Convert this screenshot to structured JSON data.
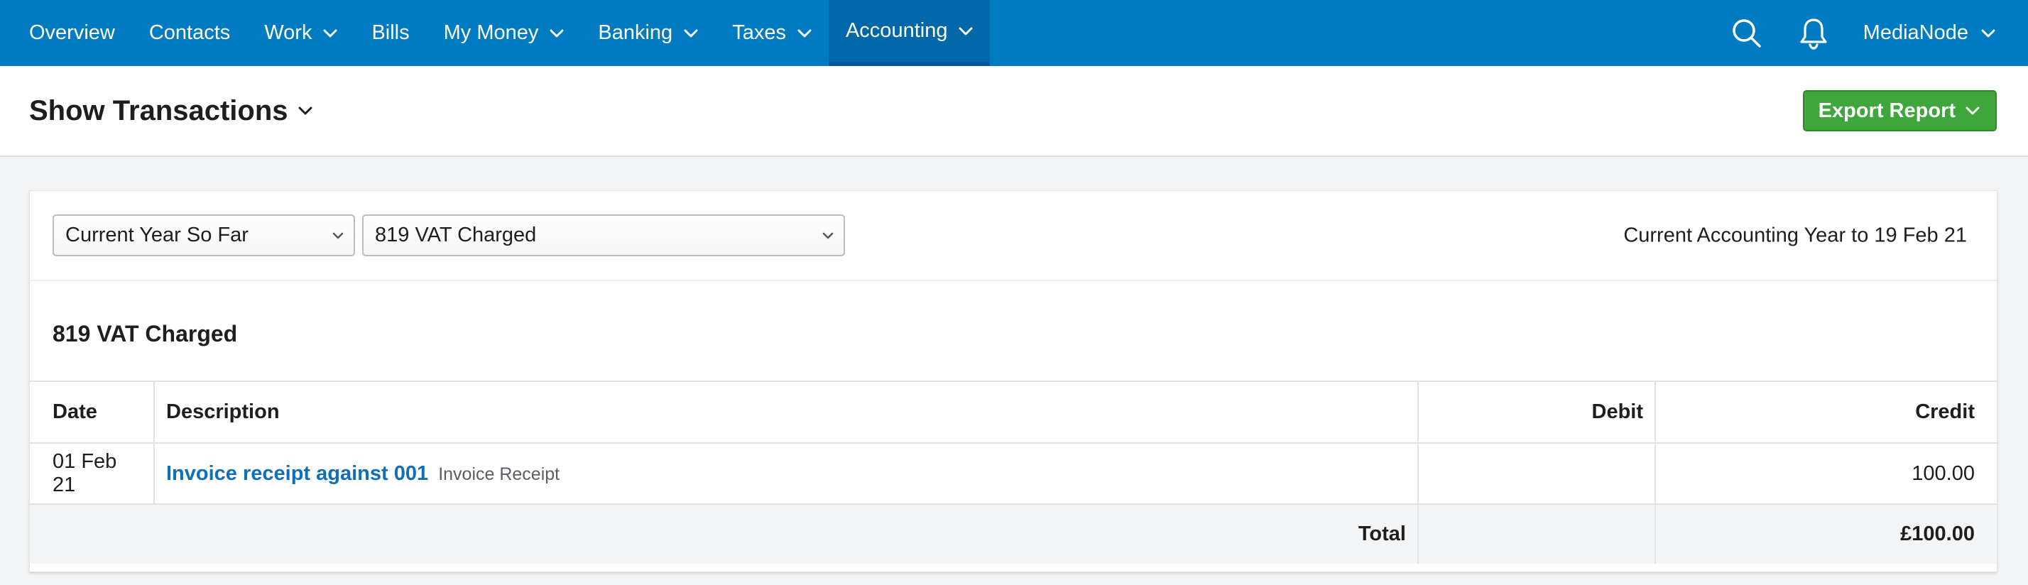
{
  "nav": {
    "items": [
      {
        "label": "Overview",
        "dropdown": false,
        "active": false
      },
      {
        "label": "Contacts",
        "dropdown": false,
        "active": false
      },
      {
        "label": "Work",
        "dropdown": true,
        "active": false
      },
      {
        "label": "Bills",
        "dropdown": false,
        "active": false
      },
      {
        "label": "My Money",
        "dropdown": true,
        "active": false
      },
      {
        "label": "Banking",
        "dropdown": true,
        "active": false
      },
      {
        "label": "Taxes",
        "dropdown": true,
        "active": false
      },
      {
        "label": "Accounting",
        "dropdown": true,
        "active": true
      }
    ],
    "search_icon": "search-icon",
    "notifications_icon": "bell-icon",
    "account_name": "MediaNode"
  },
  "header": {
    "title": "Show Transactions",
    "export_label": "Export Report"
  },
  "filters": {
    "period_value": "Current Year So Far",
    "account_value": "819 VAT Charged",
    "period_note": "Current Accounting Year to 19 Feb 21"
  },
  "report": {
    "section_title": "819 VAT Charged",
    "columns": {
      "date": "Date",
      "description": "Description",
      "debit": "Debit",
      "credit": "Credit"
    },
    "rows": [
      {
        "date": "01 Feb 21",
        "description_link": "Invoice receipt against 001",
        "description_type": "Invoice Receipt",
        "debit": "",
        "credit": "100.00"
      }
    ],
    "total": {
      "label": "Total",
      "debit": "",
      "credit": "£100.00"
    }
  },
  "colors": {
    "nav_bg": "#007bc2",
    "nav_active": "#0068a8",
    "export_green": "#3ea63a",
    "link_blue": "#0f6fb8"
  }
}
